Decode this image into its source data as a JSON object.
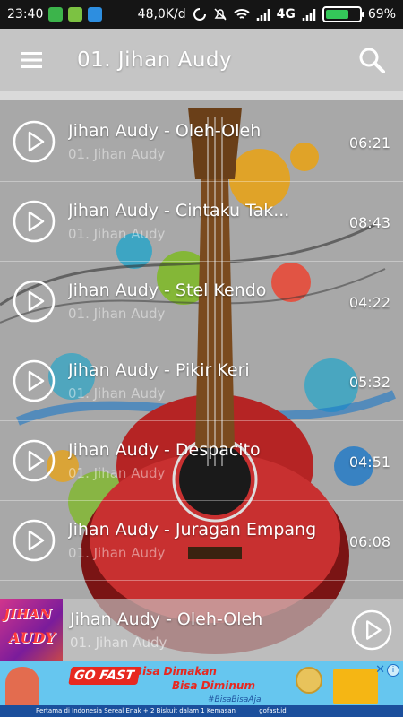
{
  "status_bar": {
    "time": "23:40",
    "speed": "48,0K/d",
    "network": "4G",
    "battery": "69%",
    "battery_level": 0.69,
    "notification_icons": [
      "app-icon",
      "robot-icon",
      "cloud-icon"
    ]
  },
  "app_bar": {
    "title": "01. Jihan Audy",
    "menu_icon": "hamburger-icon",
    "search_icon": "search-icon"
  },
  "songs": [
    {
      "title": "Jihan Audy - Oleh-Oleh",
      "album": "01. Jihan Audy",
      "duration": "06:21"
    },
    {
      "title": "Jihan Audy - Cintaku Tak...",
      "album": "01. Jihan Audy",
      "duration": "08:43"
    },
    {
      "title": "Jihan Audy - Stel Kendo",
      "album": "01. Jihan Audy",
      "duration": "04:22"
    },
    {
      "title": "Jihan Audy - Pikir Keri",
      "album": "01. Jihan Audy",
      "duration": "05:32"
    },
    {
      "title": "Jihan Audy - Despacito",
      "album": "01. Jihan Audy",
      "duration": "04:51"
    },
    {
      "title": "Jihan Audy - Juragan Empang",
      "album": "01. Jihan Audy",
      "duration": "06:08"
    }
  ],
  "now_playing": {
    "title": "Jihan Audy - Oleh-Oleh",
    "album": "01. Jihan Audy",
    "cover_line1": "JIHAN",
    "cover_line2": "AUDY"
  },
  "ad": {
    "brand": "GO FAST",
    "line1": "Bisa Dimakan",
    "line2": "Bisa Diminum",
    "hashtag": "#BisaBisaAja",
    "footer": "Pertama di Indonesia Sereal Enak + 2 Biskuit dalam 1 Kemasan",
    "social": "gofast.id"
  },
  "colors": {
    "status_bar_bg": "#151515",
    "battery_fill": "#34c759",
    "ad_bg": "#66c6ef",
    "ad_accent": "#e7281f"
  }
}
